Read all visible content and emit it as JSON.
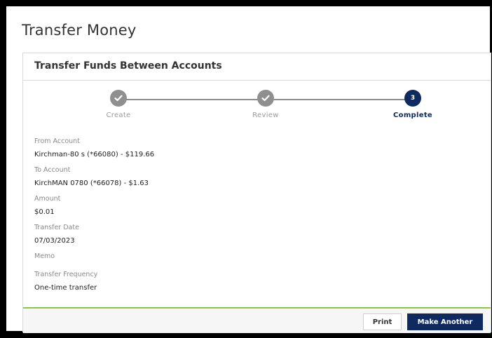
{
  "page": {
    "title": "Transfer Money"
  },
  "card": {
    "title": "Transfer Funds Between Accounts"
  },
  "stepper": {
    "steps": [
      {
        "label": "Create",
        "status": "complete",
        "icon": "check-icon"
      },
      {
        "label": "Review",
        "status": "complete",
        "icon": "check-icon"
      },
      {
        "label": "Complete",
        "status": "active",
        "number": "3"
      }
    ]
  },
  "fields": {
    "from_account": {
      "label": "From Account",
      "value": "Kirchman-80 s (*66080) - $119.66"
    },
    "to_account": {
      "label": "To Account",
      "value": "KirchMAN 0780 (*66078) - $1.63"
    },
    "amount": {
      "label": "Amount",
      "value": "$0.01"
    },
    "transfer_date": {
      "label": "Transfer Date",
      "value": "07/03/2023"
    },
    "memo": {
      "label": "Memo",
      "value": ""
    },
    "frequency": {
      "label": "Transfer Frequency",
      "value": "One-time transfer"
    }
  },
  "footer": {
    "print_label": "Print",
    "make_another_label": "Make Another"
  },
  "colors": {
    "primary": "#0f2a5e",
    "accent_line": "#8dc63f",
    "step_done": "#8f8f8f"
  }
}
